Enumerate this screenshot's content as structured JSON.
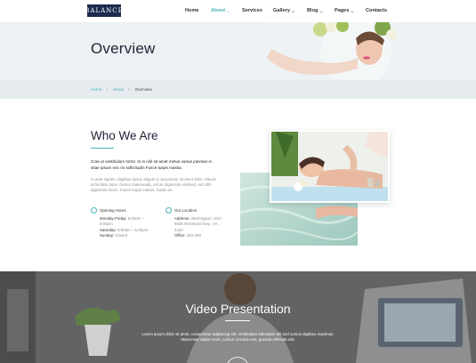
{
  "logo": "BALANCE",
  "nav": [
    {
      "label": "Home",
      "active": false,
      "dropdown": false
    },
    {
      "label": "About",
      "active": true,
      "dropdown": true
    },
    {
      "label": "Services",
      "active": false,
      "dropdown": false
    },
    {
      "label": "Gallery",
      "active": false,
      "dropdown": true
    },
    {
      "label": "Blog",
      "active": false,
      "dropdown": true
    },
    {
      "label": "Pages",
      "active": false,
      "dropdown": true
    },
    {
      "label": "Contacts",
      "active": false,
      "dropdown": false
    }
  ],
  "hero": {
    "title": "Overview"
  },
  "breadcrumb": {
    "home": "Home",
    "about": "About",
    "current": "Overview",
    "separator": ">"
  },
  "about": {
    "title": "Who We Are",
    "lead": "Cras ut vestibulum tortor. In in nisl sit amet metus varius pulvinar in vitae ipsum nec mi sollicitudin Fusce turpis massa.",
    "body": "In ante sapien, dapibus luctus aliquet a, accumsan sit amet dolor. Mauris at facilisis dolor. Donec malesuada, est ac dignissim eleifend, est nibh dignissim lorem. Fusce turpis massa, mattis sit."
  },
  "hours": {
    "title": "Opening Hours",
    "mf_label": "Monday-Friday:",
    "mf_value": "8:00am – 8:00pm",
    "sat_label": "Saturday:",
    "sat_value": "8:00am – 6:30pm",
    "sun_label": "Sunday:",
    "sun_value": "Closed"
  },
  "location": {
    "title": "Our Location",
    "addr_label": "Address:",
    "addr_value": "Washington, USA 6036 Richmond hwy., VA, 2230",
    "phone_label": "Office:",
    "phone_value": "284-290"
  },
  "video": {
    "title": "Video Presentation",
    "text": "Lorem ipsum dolor sit amet, consectetur adipiscing elit. Vestibulum bibendum elit sed cursus dapibus maximus. Maecenas sapien eros, cursus ut turpis non, gravida vehicula nisl."
  },
  "colors": {
    "accent": "#48b3bd",
    "logo_bg": "#1d2a4d",
    "hero_bg": "#edf1f4",
    "video_bg": "#5e5f60"
  }
}
